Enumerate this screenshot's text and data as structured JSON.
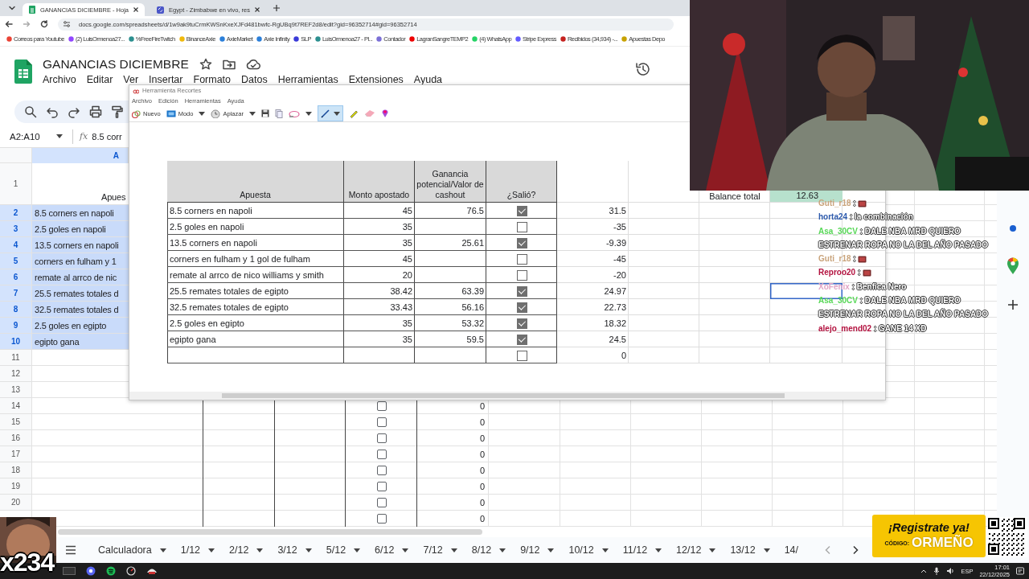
{
  "browser": {
    "tabs": [
      {
        "title": "GANANCIAS DICIEMBRE - Hoja",
        "selected": true
      },
      {
        "title": "Egypt - Zimbabwe en vivo, res",
        "selected": false
      }
    ],
    "url": "docs.google.com/spreadsheets/d/1w9ak9tuCrmKWSnKxeXJFd481bwfc-RgUBq9t7REF2d8/edit?gid=96352714#gid=96352714",
    "bookmarks": [
      "Correos para Youtube",
      "(2) LuisOrmenoa27...",
      "%FreeFireTwitch",
      "BinanceAxie",
      "AxieMarket",
      "Axie Infinity",
      "SLP",
      "LuisOrmenoa27 - Pl...",
      "Contador",
      "LagranSangreTEMP2",
      "(4) WhatsApp",
      "Stripe Express",
      "Recibidos (34,934) -...",
      "Apuestas Depo"
    ]
  },
  "sheet": {
    "title": "GANANCIAS DICIEMBRE",
    "menu": [
      "Archivo",
      "Editar",
      "Ver",
      "Insertar",
      "Formato",
      "Datos",
      "Herramientas",
      "Extensiones",
      "Ayuda"
    ],
    "name_box": "A2:A10",
    "formula_label": "fx",
    "formula": "8.5 corr",
    "column_header": "A",
    "rows": [
      {
        "kind": "header",
        "number": "1",
        "text": "Apues",
        "selected": false
      },
      {
        "kind": "text",
        "number": "2",
        "text": "8.5 corners en napoli",
        "selected": true
      },
      {
        "kind": "text",
        "number": "3",
        "text": "2.5 goles en napoli",
        "selected": true
      },
      {
        "kind": "text",
        "number": "4",
        "text": "13.5 corners en napoli",
        "selected": true
      },
      {
        "kind": "text",
        "number": "5",
        "text": "corners en fulham y 1",
        "selected": true
      },
      {
        "kind": "text",
        "number": "6",
        "text": "remate al arrco de nic",
        "selected": true
      },
      {
        "kind": "text",
        "number": "7",
        "text": "25.5 remates totales d",
        "selected": true
      },
      {
        "kind": "text",
        "number": "8",
        "text": "32.5 remates totales d",
        "selected": true
      },
      {
        "kind": "text",
        "number": "9",
        "text": "2.5 goles en egipto",
        "selected": true
      },
      {
        "kind": "text",
        "number": "10",
        "text": "egipto gana",
        "selected": true
      },
      {
        "kind": "blank",
        "number": "11"
      },
      {
        "kind": "blank",
        "number": "12"
      },
      {
        "kind": "blank",
        "number": "13"
      },
      {
        "kind": "checkbox",
        "number": "14",
        "checked": false,
        "value": "0"
      },
      {
        "kind": "checkbox",
        "number": "15",
        "checked": false,
        "value": "0"
      },
      {
        "kind": "checkbox",
        "number": "16",
        "checked": false,
        "value": "0"
      },
      {
        "kind": "checkbox",
        "number": "17",
        "checked": false,
        "value": "0"
      },
      {
        "kind": "checkbox",
        "number": "18",
        "checked": false,
        "value": "0"
      },
      {
        "kind": "checkbox",
        "number": "19",
        "checked": false,
        "value": "0"
      },
      {
        "kind": "checkbox",
        "number": "20",
        "checked": false,
        "value": "0"
      },
      {
        "kind": "checkbox",
        "checked": false,
        "value": "0"
      }
    ],
    "tabs": [
      {
        "label": "Calculadora",
        "selected": false
      },
      {
        "label": "1/12",
        "selected": false
      },
      {
        "label": "2/12",
        "selected": false
      },
      {
        "label": "3/12",
        "selected": false
      },
      {
        "label": "5/12",
        "selected": false
      },
      {
        "label": "6/12",
        "selected": false
      },
      {
        "label": "7/12",
        "selected": false
      },
      {
        "label": "8/12",
        "selected": false
      },
      {
        "label": "9/12",
        "selected": false
      },
      {
        "label": "10/12",
        "selected": false
      },
      {
        "label": "11/12",
        "selected": false
      },
      {
        "label": "12/12",
        "selected": false
      },
      {
        "label": "13/12",
        "selected": false
      },
      {
        "label": "14/",
        "selected": false
      }
    ]
  },
  "snipping_tool": {
    "title": "Herramienta Recortes",
    "menu": [
      "Archivo",
      "Edición",
      "Herramientas",
      "Ayuda"
    ],
    "toolbar": [
      "Nuevo",
      "Modo",
      "Aplazar"
    ],
    "table": {
      "columns": [
        "Apuesta",
        "Monto apostado",
        "Ganancia potencial/Valor de cashout",
        "¿Salió?"
      ],
      "balance_label": "Balance total",
      "balance_value": "12.63",
      "rows": [
        {
          "bet": "8.5 corners en napoli",
          "amount": "45",
          "payout": "76.5",
          "won": true,
          "result": "31.5",
          "selected": false
        },
        {
          "bet": "2.5 goles en napoli",
          "amount": "35",
          "won": false,
          "result": "-35",
          "selected": false
        },
        {
          "bet": "13.5 corners en napoli",
          "amount": "35",
          "payout": "25.61",
          "won": true,
          "result": "-9.39",
          "selected": false
        },
        {
          "bet": "corners en fulham y 1 gol de fulham",
          "amount": "45",
          "won": false,
          "result": "-45",
          "selected": false
        },
        {
          "bet": "remate al arrco de nico williams y smith",
          "amount": "20",
          "won": false,
          "result": "-20",
          "selected": false
        },
        {
          "bet": "25.5 remates totales de egipto",
          "amount": "38.42",
          "payout": "63.39",
          "won": true,
          "result": "24.97",
          "selected": true
        },
        {
          "bet": "32.5 remates totales de egipto",
          "amount": "33.43",
          "payout": "56.16",
          "won": true,
          "result": "22.73",
          "selected": false
        },
        {
          "bet": "2.5 goles en egipto",
          "amount": "35",
          "payout": "53.32",
          "won": true,
          "result": "18.32",
          "selected": false
        },
        {
          "bet": "egipto gana",
          "amount": "35",
          "payout": "59.5",
          "won": true,
          "result": "24.5",
          "selected": false
        },
        {
          "won": false,
          "result": "0",
          "selected": false
        }
      ]
    }
  },
  "chat": [
    {
      "user": "Guti_r18",
      "color": "#c9a47c",
      "kind": "emote",
      "message": ":"
    },
    {
      "user": "horta24",
      "color": "#2f5cae",
      "kind": "text",
      "message": ": la combinación"
    },
    {
      "user": "Asa_30CV",
      "color": "#58d858",
      "kind": "text",
      "message": ": DALE NBA MRD QUIERO ESTRENAR ROPA NO LA DEL AÑO PASADO"
    },
    {
      "user": "Guti_r18",
      "color": "#c9a47c",
      "kind": "emote",
      "message": ":"
    },
    {
      "user": "Reproo20",
      "color": "#b3123f",
      "kind": "emote",
      "message": ":"
    },
    {
      "user": "XoFenix",
      "color": "#e2a6c6",
      "kind": "text",
      "message": ": Benfica Nero"
    },
    {
      "user": "Asa_30CV",
      "color": "#58d858",
      "kind": "text",
      "message": ": DALE NBA MRD QUIERO ESTRENAR ROPA NO LA DEL AÑO PASADO"
    },
    {
      "user": "alejo_mend02",
      "color": "#b3123f",
      "kind": "text",
      "message": ": GANE 14 XD"
    }
  ],
  "promo": {
    "headline": "¡Registrate ya!",
    "code_label": "CÓDIGO:",
    "code": "ORMEÑO"
  },
  "emote_counter": "x234",
  "taskbar": {
    "language": "ESP",
    "time": "17:01",
    "date": "22/12/2025"
  }
}
